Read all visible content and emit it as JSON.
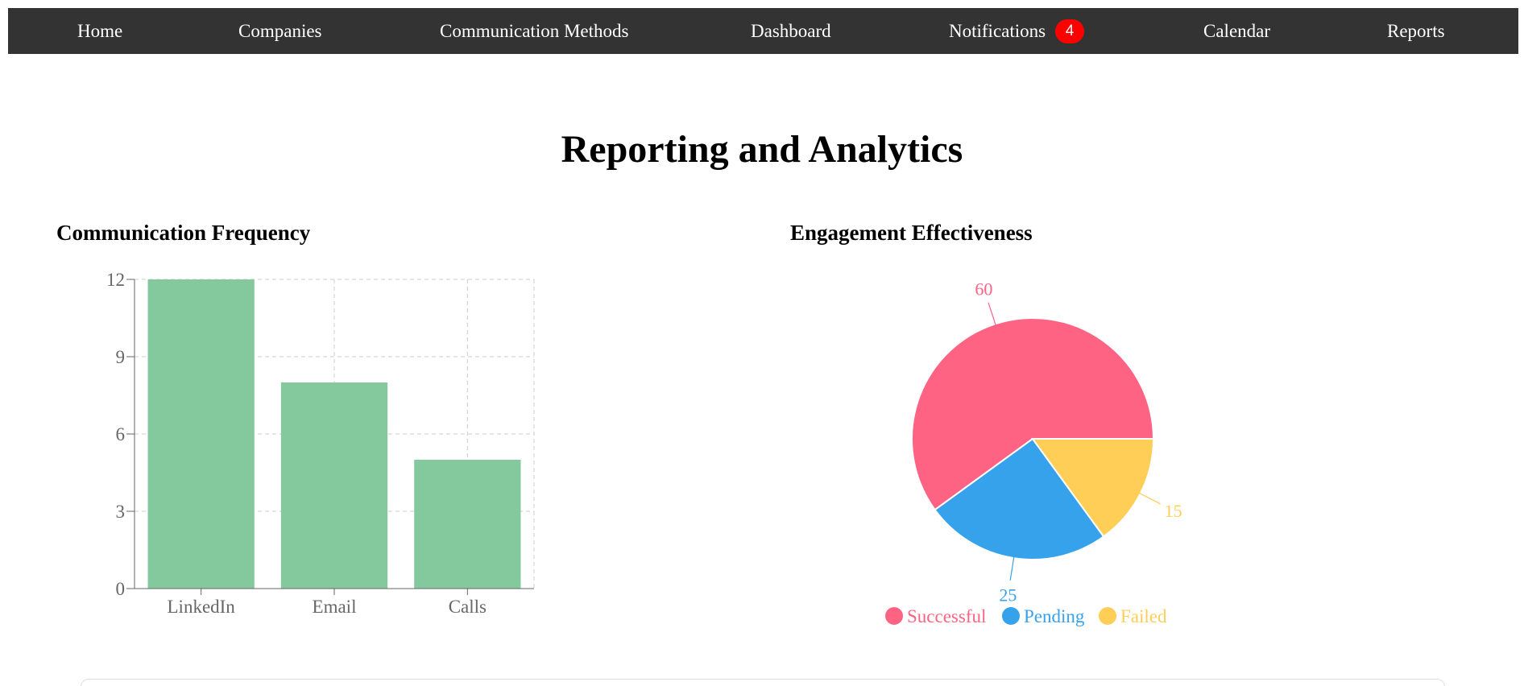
{
  "nav": {
    "home": "Home",
    "companies": "Companies",
    "communication_methods": "Communication Methods",
    "dashboard": "Dashboard",
    "notifications": "Notifications",
    "notifications_count": "4",
    "calendar": "Calendar",
    "reports": "Reports"
  },
  "page_title": "Reporting and Analytics",
  "sections": {
    "frequency_title": "Communication Frequency",
    "engagement_title": "Engagement Effectiveness"
  },
  "colors": {
    "nav_bg": "#333333",
    "badge": "#ff0000",
    "bar": "#84c99d",
    "successful": "#ff6384",
    "pending": "#36a2eb",
    "failed": "#ffce56"
  },
  "chart_data": [
    {
      "type": "bar",
      "title": "Communication Frequency",
      "categories": [
        "LinkedIn",
        "Email",
        "Calls"
      ],
      "values": [
        12,
        8,
        5
      ],
      "ylim": [
        0,
        12
      ],
      "yticks": [
        0,
        3,
        6,
        9,
        12
      ],
      "grid": true,
      "legend": "none"
    },
    {
      "type": "pie",
      "title": "Engagement Effectiveness",
      "labels": [
        "Successful",
        "Pending",
        "Failed"
      ],
      "values": [
        60,
        25,
        15
      ],
      "colors": [
        "#ff6384",
        "#36a2eb",
        "#ffce56"
      ],
      "legend": "bottom"
    }
  ]
}
